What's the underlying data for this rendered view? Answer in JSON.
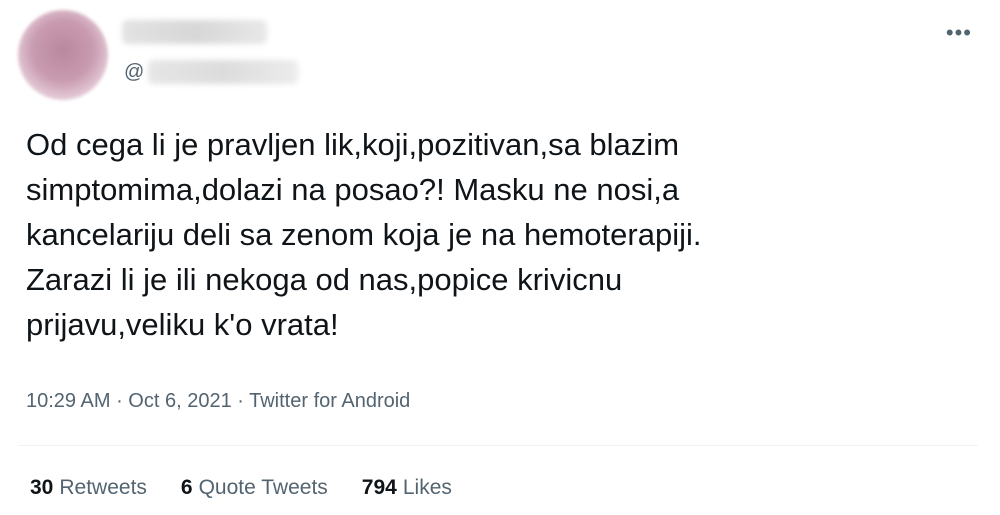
{
  "tweet": {
    "handle_prefix": "@",
    "more_label": "•••",
    "text": "Od cega li je pravljen lik,koji,pozitivan,sa blazim\nsimptomima,dolazi na posao?! Masku ne nosi,a\nkancelariju deli sa zenom koja je na hemoterapiji.\nZarazi li je ili nekoga od nas,popice krivicnu\nprijavu,veliku k'o vrata!",
    "time": "10:29 AM",
    "separator": " · ",
    "date": "Oct 6, 2021",
    "source": "Twitter for Android"
  },
  "stats": {
    "retweets_count": "30",
    "retweets_label": "Retweets",
    "quotes_count": "6",
    "quotes_label": "Quote Tweets",
    "likes_count": "794",
    "likes_label": "Likes"
  },
  "colors": {
    "text": "#0f1419",
    "secondary": "#536471",
    "divider": "#eff3f4"
  }
}
